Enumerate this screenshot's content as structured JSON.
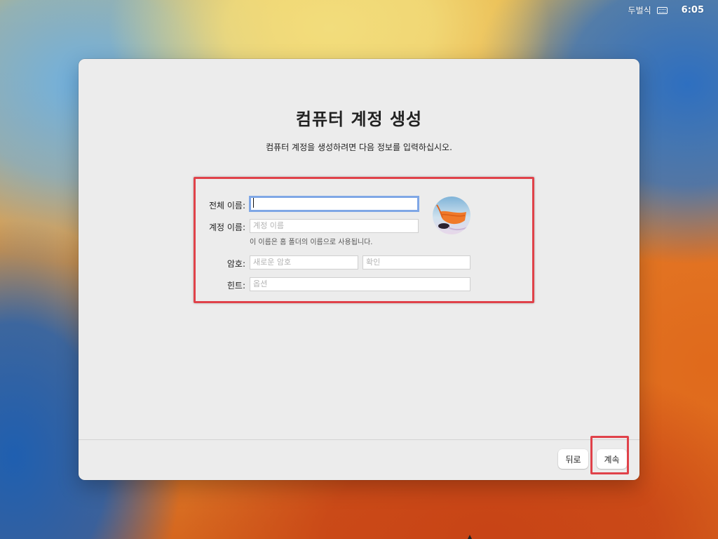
{
  "menubar": {
    "input_source": "두벌식",
    "clock": "6:05"
  },
  "window": {
    "title": "컴퓨터 계정 생성",
    "subtitle": "컴퓨터 계정을 생성하려면 다음 정보를 입력하십시오."
  },
  "form": {
    "full_name": {
      "label": "전체 이름:",
      "value": ""
    },
    "account_name": {
      "label": "계정 이름:",
      "placeholder": "계정 이름",
      "note": "이 이름은 홈 폴더의 이름으로 사용됩니다."
    },
    "password": {
      "label": "암호:",
      "placeholder": "새로운 암호",
      "verify_placeholder": "확인"
    },
    "hint": {
      "label": "힌트:",
      "placeholder": "옵션"
    }
  },
  "footer": {
    "back_label": "뒤로",
    "continue_label": "계속"
  },
  "colors": {
    "highlight": "#e0424a",
    "focus_ring": "#7fa7e6"
  }
}
